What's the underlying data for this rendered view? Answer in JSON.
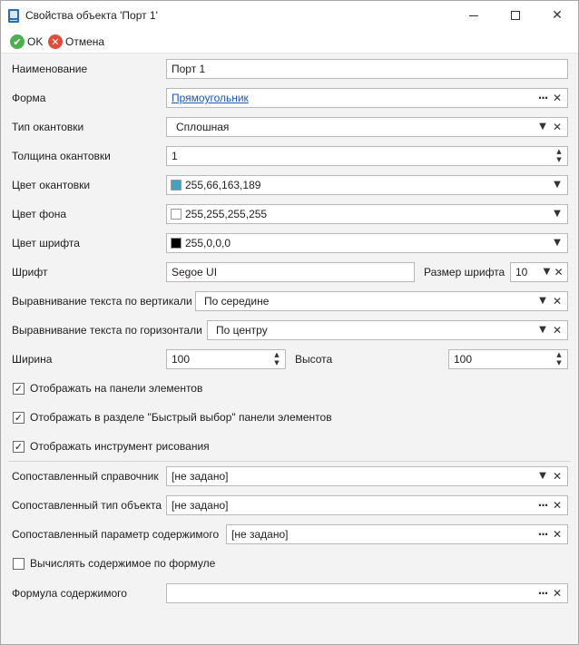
{
  "window": {
    "title": "Свойства объекта 'Порт 1'",
    "minimize": "—",
    "maximize": "□",
    "close": "✕"
  },
  "toolbar": {
    "ok_label": "OK",
    "cancel_label": "Отмена",
    "ok_icon": "✔",
    "cancel_icon": "✕"
  },
  "form": {
    "name": {
      "label": "Наименование",
      "value": "Порт 1"
    },
    "shape": {
      "label": "Форма",
      "value": "Прямоугольник"
    },
    "border_type": {
      "label": "Тип окантовки",
      "value": "Сплошная"
    },
    "border_width": {
      "label": "Толщина окантовки",
      "value": "1"
    },
    "border_color": {
      "label": "Цвет окантовки",
      "value": "255,66,163,189",
      "swatch": "#42a3bd"
    },
    "bg_color": {
      "label": "Цвет фона",
      "value": "255,255,255,255",
      "swatch": "#ffffff"
    },
    "font_color": {
      "label": "Цвет шрифта",
      "value": "255,0,0,0",
      "swatch": "#000000"
    },
    "font": {
      "label": "Шрифт",
      "value": "Segoe UI"
    },
    "font_size": {
      "label": "Размер шрифта",
      "value": "10"
    },
    "valign": {
      "label": "Выравнивание текста по вертикали",
      "value": "По середине"
    },
    "halign": {
      "label": "Выравнивание текста по горизонтали",
      "value": "По центру"
    },
    "width": {
      "label": "Ширина",
      "value": "100"
    },
    "height": {
      "label": "Высота",
      "value": "100"
    },
    "show_on_panel": {
      "label": "Отображать на панели элементов",
      "checked": true
    },
    "show_quick_select": {
      "label": "Отображать в разделе \"Быстрый выбор\" панели элементов",
      "checked": true
    },
    "show_drawing_tool": {
      "label": "Отображать инструмент рисования",
      "checked": true
    },
    "linked_directory": {
      "label": "Сопоставленный справочник",
      "value": "[не задано]"
    },
    "linked_object_type": {
      "label": "Сопоставленный тип объекта",
      "value": "[не задано]"
    },
    "linked_content_param": {
      "label": "Сопоставленный параметр содержимого",
      "value": "[не задано]"
    },
    "compute_by_formula": {
      "label": "Вычислять содержимое по формуле",
      "checked": false
    },
    "content_formula": {
      "label": "Формула содержимого",
      "value": ""
    }
  },
  "glyphs": {
    "check": "✓",
    "dropdown": "▼",
    "clear": "✕",
    "ellipsis": "···",
    "spin_up": "▲",
    "spin_down": "▼"
  }
}
